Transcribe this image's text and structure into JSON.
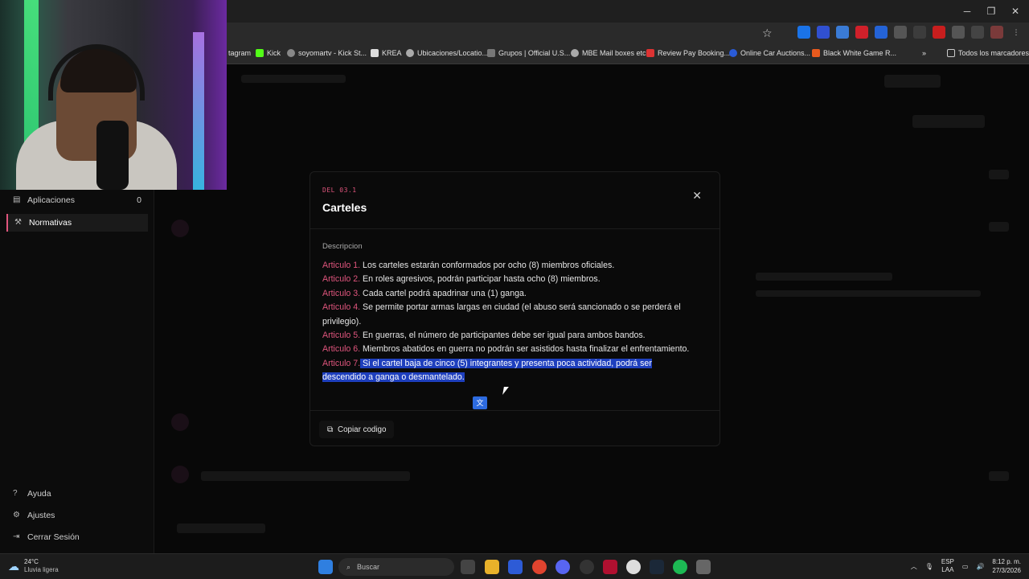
{
  "browser": {
    "bookmarks": [
      {
        "label": "tagram",
        "color": "#555"
      },
      {
        "label": "Kick",
        "color": "#53fc18"
      },
      {
        "label": "soyomartv - Kick St...",
        "color": "#888"
      },
      {
        "label": "KREA",
        "color": "#ddd"
      },
      {
        "label": "Ubicaciones/Locatio...",
        "color": "#aaa"
      },
      {
        "label": "Grupos | Official U.S...",
        "color": "#777"
      },
      {
        "label": "MBE Mail boxes etc",
        "color": "#aaa"
      },
      {
        "label": "Review Pay Booking...",
        "color": "#d33"
      },
      {
        "label": "Online Car Auctions...",
        "color": "#2a5bd7"
      },
      {
        "label": "Black White Game R...",
        "color": "#e85a1e"
      }
    ],
    "more_bookmarks": "»",
    "all_bookmarks": "Todos los marcadores"
  },
  "sidebar": {
    "items": [
      {
        "label": "Aplicaciones",
        "count": "0",
        "icon": "document-icon"
      },
      {
        "label": "Normativas",
        "icon": "gavel-icon"
      }
    ],
    "footer": [
      {
        "label": "Ayuda",
        "icon": "help-icon"
      },
      {
        "label": "Ajustes",
        "icon": "gear-icon"
      },
      {
        "label": "Cerrar Sesión",
        "icon": "logout-icon"
      }
    ]
  },
  "modal": {
    "code": "DEL 03.1",
    "title": "Carteles",
    "description_label": "Descripcion",
    "articles": [
      {
        "label": "Articulo 1.",
        "text": " Los carteles estarán conformados por ocho (8) miembros oficiales."
      },
      {
        "label": "Articulo 2.",
        "text": " En roles agresivos, podrán participar hasta ocho (8) miembros."
      },
      {
        "label": "Articulo 3.",
        "text": " Cada cartel podrá apadrinar una (1) ganga."
      },
      {
        "label": "Articulo 4.",
        "text": " Se permite portar armas largas en ciudad (el abuso será sancionado o se perderá el privilegio)."
      },
      {
        "label": "Articulo 5.",
        "text": " En guerras, el número de participantes debe ser igual para ambos bandos."
      },
      {
        "label": "Articulo 6.",
        "text": " Miembros abatidos en guerra no podrán ser asistidos hasta finalizar el enfrentamiento."
      },
      {
        "label": "Articulo 7.",
        "text": " Si el cartel baja de cinco (5) integrantes y presenta poca actividad, podrá ser descendido a ganga o desmantelado."
      }
    ],
    "copy_button": "Copiar codigo",
    "close_symbol": "✕"
  },
  "taskbar": {
    "temperature": "24°C",
    "weather": "Lluvia ligera",
    "search_placeholder": "Buscar",
    "language_top": "ESP",
    "language_bottom": "LAA",
    "time": "8:12 p. m.",
    "date": "27/3/2026"
  },
  "colors": {
    "accent": "#e0557d",
    "selection": "#1e3fbd"
  }
}
